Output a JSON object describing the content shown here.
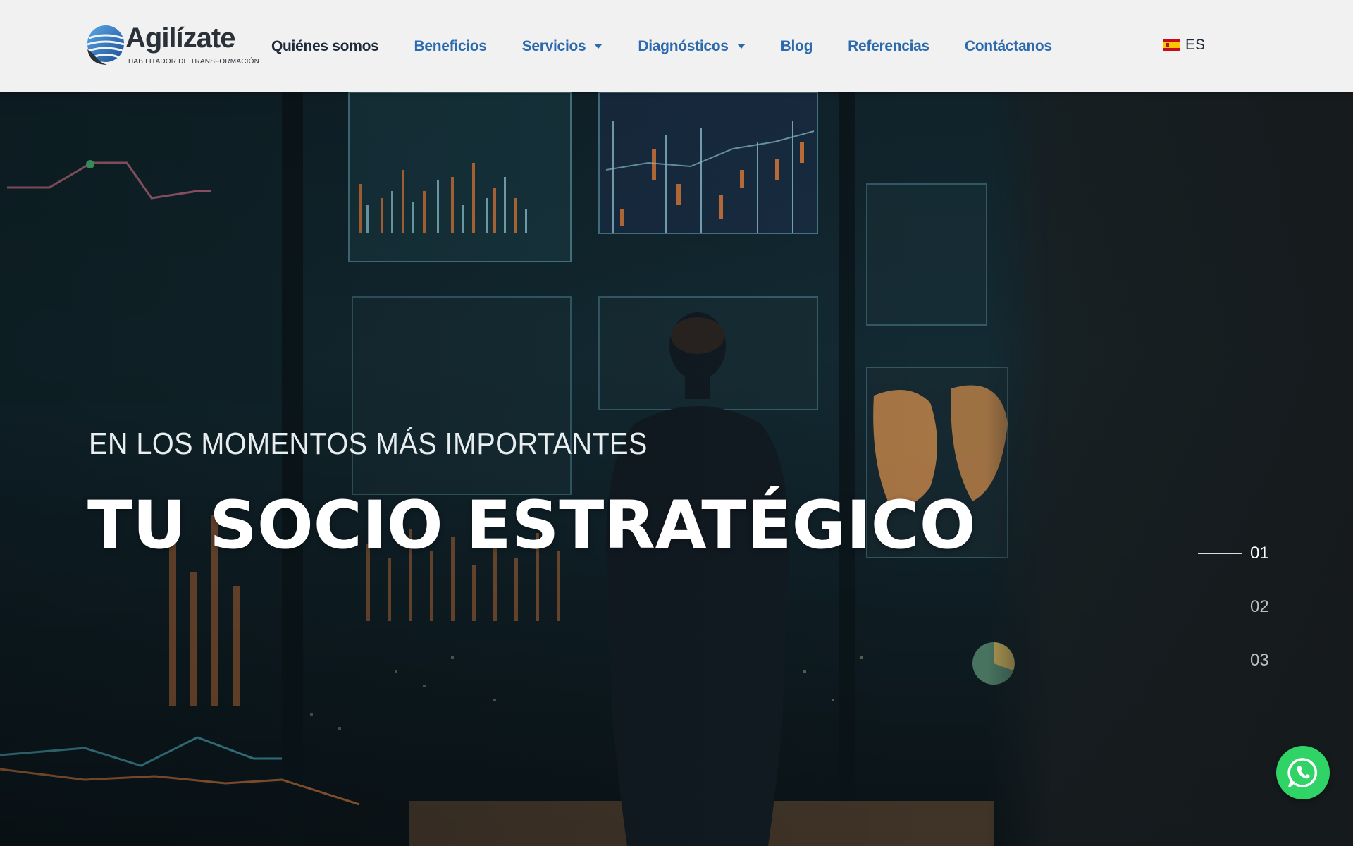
{
  "brand": {
    "name": "Agilízate",
    "tagline": "HABILITADOR DE TRANSFORMACIÓN"
  },
  "nav": {
    "items": [
      {
        "label": "Quiénes somos",
        "active": true,
        "dropdown": false
      },
      {
        "label": "Beneficios",
        "active": false,
        "dropdown": false
      },
      {
        "label": "Servicios",
        "active": false,
        "dropdown": true
      },
      {
        "label": "Diagnósticos",
        "active": false,
        "dropdown": true
      },
      {
        "label": "Blog",
        "active": false,
        "dropdown": false
      },
      {
        "label": "Referencias",
        "active": false,
        "dropdown": false
      },
      {
        "label": "Contáctanos",
        "active": false,
        "dropdown": false
      }
    ]
  },
  "language": {
    "label": "ES",
    "flag_icon": "spain-flag-icon"
  },
  "hero": {
    "kicker": "EN LOS MOMENTOS MÁS IMPORTANTES",
    "headline": "TU SOCIO ESTRATÉGICO",
    "slides": [
      "01",
      "02",
      "03"
    ],
    "active_slide": "01"
  },
  "whatsapp": {
    "icon": "whatsapp-icon"
  },
  "colors": {
    "nav_link": "#2d6aad",
    "nav_active": "#1f2a3a",
    "header_bg": "#f1f1f1",
    "whatsapp": "#2fd366"
  }
}
